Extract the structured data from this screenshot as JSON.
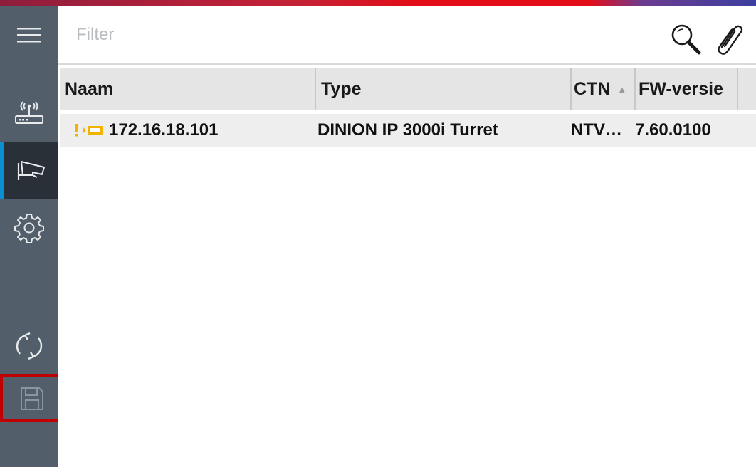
{
  "filter": {
    "placeholder": "Filter"
  },
  "sidebar": {
    "items": [
      {
        "icon": "hamburger-menu-icon"
      },
      {
        "icon": "network-device-icon"
      },
      {
        "icon": "camera-icon",
        "active": true
      },
      {
        "icon": "gear-icon"
      },
      {
        "icon": "refresh-icon"
      },
      {
        "icon": "save-icon"
      }
    ]
  },
  "table": {
    "columns": [
      {
        "label": "Naam"
      },
      {
        "label": "Type"
      },
      {
        "label": "CTN",
        "sort": "ascending"
      },
      {
        "label": "FW-versie"
      }
    ],
    "rows": [
      {
        "naam": "172.16.18.101",
        "type": "DINION IP 3000i Turret",
        "ctn": "NTV…",
        "fw": "7.60.0100",
        "status_icon": "warning-camera-icon"
      }
    ]
  },
  "colors": {
    "sidebar": "#525f6b",
    "sidebar_active": "#2a3037",
    "active_indicator": "#0a8fd0",
    "highlight_border": "#c00000",
    "warning": "#f0b400"
  }
}
